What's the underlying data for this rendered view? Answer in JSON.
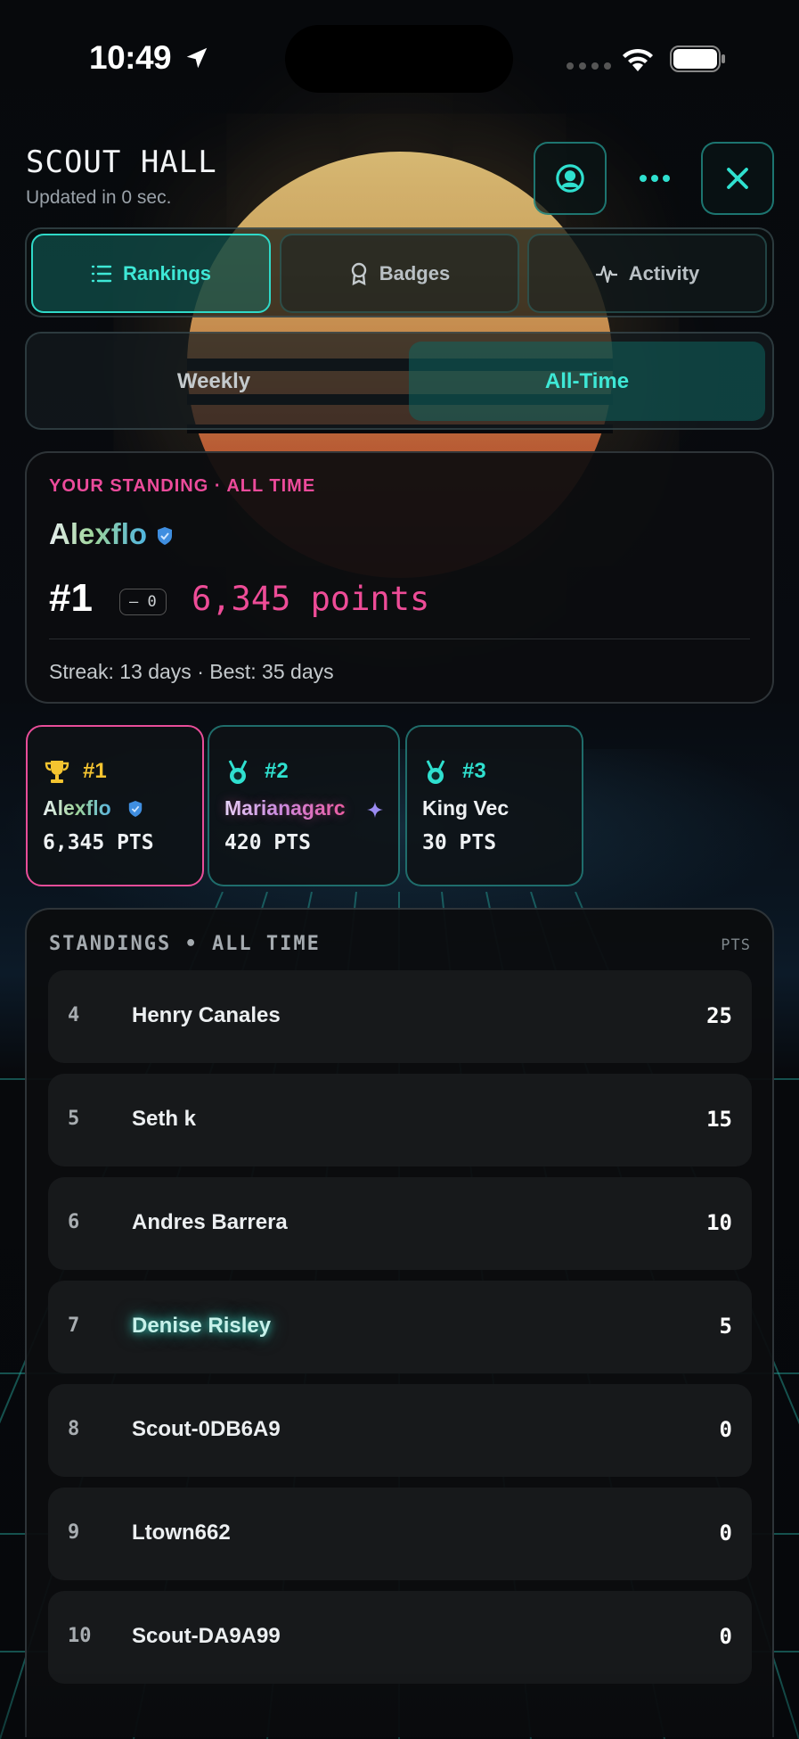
{
  "status_bar": {
    "time": "10:49"
  },
  "header": {
    "title": "SCOUT HALL",
    "subtitle": "Updated in 0 sec."
  },
  "tabs": [
    {
      "label": "Rankings",
      "icon": "list-icon",
      "active": true
    },
    {
      "label": "Badges",
      "icon": "ribbon-icon",
      "active": false
    },
    {
      "label": "Activity",
      "icon": "pulse-icon",
      "active": false
    }
  ],
  "period": {
    "options": [
      "Weekly",
      "All-Time"
    ],
    "selected": "All-Time"
  },
  "standing": {
    "label": "YOUR STANDING · ALL TIME",
    "name": "Alexflo",
    "rank": "#1",
    "delta": "— 0",
    "points": "6,345 points",
    "streak": "Streak: 13 days  ·  Best: 35 days"
  },
  "podium": [
    {
      "rank": "#1",
      "name": "Alexflo",
      "pts": "6,345 PTS",
      "icon": "trophy-icon",
      "color": "#f4c430"
    },
    {
      "rank": "#2",
      "name": "Marianagarc",
      "pts": "420 PTS",
      "icon": "medal-icon",
      "color": "#2fe0cf"
    },
    {
      "rank": "#3",
      "name": "King Vec",
      "pts": "30 PTS",
      "icon": "medal-icon",
      "color": "#2fe0cf"
    }
  ],
  "standings": {
    "heading": "STANDINGS • ALL TIME",
    "pts_label": "PTS",
    "rows": [
      {
        "rank": "4",
        "name": "Henry Canales",
        "score": "25"
      },
      {
        "rank": "5",
        "name": "Seth k",
        "score": "15"
      },
      {
        "rank": "6",
        "name": "Andres Barrera",
        "score": "10"
      },
      {
        "rank": "7",
        "name": "Denise Risley",
        "score": "5"
      },
      {
        "rank": "8",
        "name": "Scout-0DB6A9",
        "score": "0"
      },
      {
        "rank": "9",
        "name": "Ltown662",
        "score": "0"
      },
      {
        "rank": "10",
        "name": "Scout-DA9A99",
        "score": "0"
      }
    ]
  },
  "colors": {
    "accent": "#2fd9c8",
    "pink": "#ec4b9b",
    "gold": "#f4c430"
  }
}
